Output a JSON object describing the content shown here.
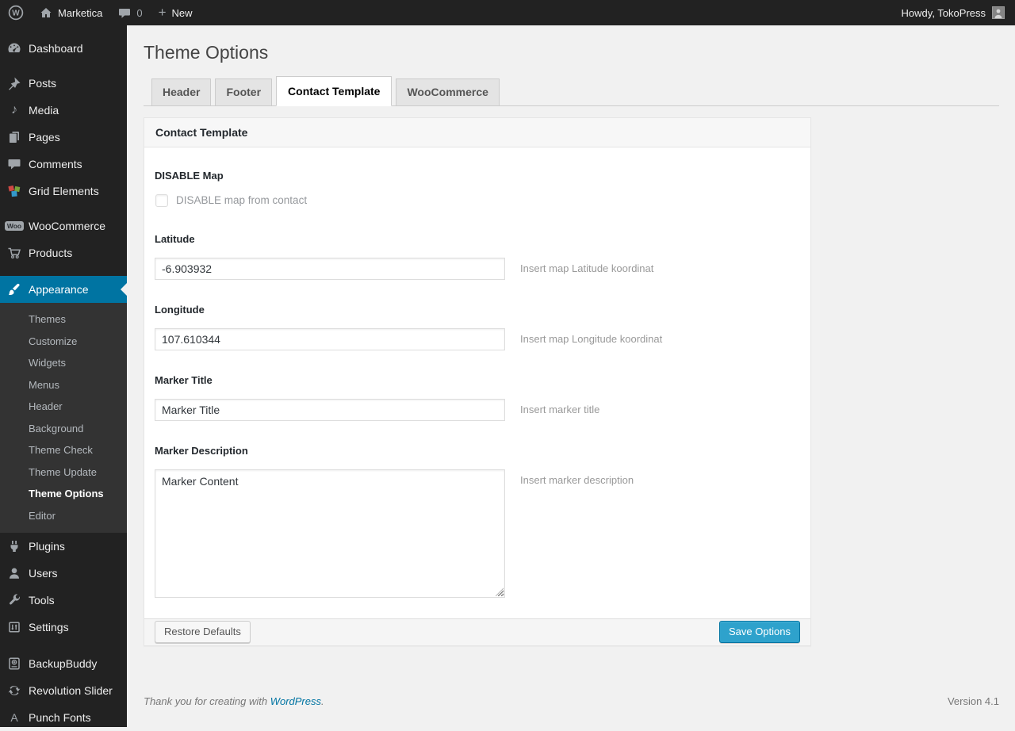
{
  "admin_bar": {
    "site_name": "Marketica",
    "comment_count": "0",
    "new_label": "New",
    "howdy": "Howdy, TokoPress"
  },
  "sidebar": {
    "items": [
      {
        "label": "Dashboard",
        "icon": "dashboard-icon"
      },
      {
        "label": "Posts",
        "icon": "pin-icon"
      },
      {
        "label": "Media",
        "icon": "music-note-icon"
      },
      {
        "label": "Pages",
        "icon": "pages-icon"
      },
      {
        "label": "Comments",
        "icon": "comment-icon"
      },
      {
        "label": "Grid Elements",
        "icon": "grid-pinwheel-icon"
      },
      {
        "label": "WooCommerce",
        "icon": "woo-badge-icon"
      },
      {
        "label": "Products",
        "icon": "cart-icon"
      },
      {
        "label": "Appearance",
        "icon": "brush-icon",
        "active": true
      },
      {
        "label": "Plugins",
        "icon": "plug-icon"
      },
      {
        "label": "Users",
        "icon": "user-icon"
      },
      {
        "label": "Tools",
        "icon": "wrench-icon"
      },
      {
        "label": "Settings",
        "icon": "sliders-icon"
      },
      {
        "label": "BackupBuddy",
        "icon": "backup-drive-icon"
      },
      {
        "label": "Revolution Slider",
        "icon": "refresh-arrows-icon"
      },
      {
        "label": "Punch Fonts",
        "icon": "letter-a-icon"
      }
    ],
    "woo_badge_text": "Woo",
    "punch_fonts_glyph": "A",
    "media_glyph": "♪",
    "appearance_submenu": [
      {
        "label": "Themes"
      },
      {
        "label": "Customize"
      },
      {
        "label": "Widgets"
      },
      {
        "label": "Menus"
      },
      {
        "label": "Header"
      },
      {
        "label": "Background"
      },
      {
        "label": "Theme Check"
      },
      {
        "label": "Theme Update"
      },
      {
        "label": "Theme Options",
        "current": true
      },
      {
        "label": "Editor"
      }
    ]
  },
  "main": {
    "title": "Theme Options",
    "tabs": [
      {
        "label": "Header",
        "active": false
      },
      {
        "label": "Footer",
        "active": false
      },
      {
        "label": "Contact Template",
        "active": true
      },
      {
        "label": "WooCommerce",
        "active": false
      }
    ],
    "panel": {
      "title": "Contact Template",
      "fields": {
        "disable_map": {
          "label": "DISABLE Map",
          "checkbox_label": "DISABLE map from contact",
          "checked": false
        },
        "latitude": {
          "label": "Latitude",
          "value": "-6.903932",
          "hint": "Insert map Latitude koordinat"
        },
        "longitude": {
          "label": "Longitude",
          "value": "107.610344",
          "hint": "Insert map Longitude koordinat"
        },
        "marker_title": {
          "label": "Marker Title",
          "value": "Marker Title",
          "hint": "Insert marker title"
        },
        "marker_description": {
          "label": "Marker Description",
          "value": "Marker Content",
          "hint": "Insert marker description"
        }
      },
      "buttons": {
        "restore": "Restore Defaults",
        "save": "Save Options"
      }
    }
  },
  "page_footer": {
    "thanks_prefix": "Thank you for creating with ",
    "link_text": "WordPress",
    "suffix": ".",
    "version": "Version 4.1"
  },
  "colors": {
    "accent": "#0074a2",
    "primary_button": "#2ea2cc",
    "menu_bg": "#222222",
    "submenu_bg": "#333333",
    "page_bg": "#f1f1f1"
  }
}
